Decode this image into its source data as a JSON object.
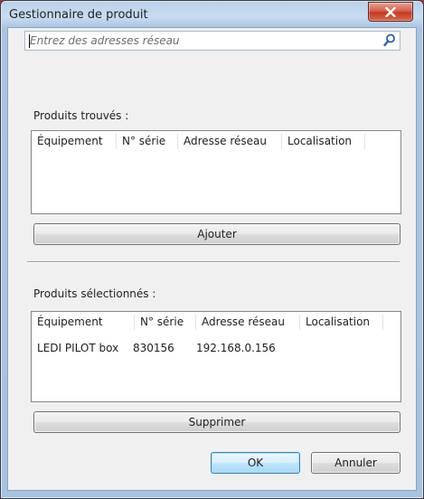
{
  "window": {
    "title": "Gestionnaire de produit"
  },
  "search": {
    "placeholder": "Entrez des adresses réseau",
    "value": ""
  },
  "found": {
    "label": "Produits trouvés :",
    "columns": [
      "Équipement",
      "N° série",
      "Adresse réseau",
      "Localisation"
    ],
    "rows": []
  },
  "add_button": "Ajouter",
  "selected": {
    "label": "Produits sélectionnés :",
    "columns": [
      "Équipement",
      "N° série",
      "Adresse réseau",
      "Localisation"
    ],
    "rows": [
      [
        "LEDI PILOT box",
        "830156",
        "192.168.0.156",
        ""
      ]
    ]
  },
  "remove_button": "Supprimer",
  "ok_button": "OK",
  "cancel_button": "Annuler",
  "colors": {
    "title_close": "#c43a22",
    "ok_accent": "#3c7fb1",
    "search_icon": "#2a5fa8"
  },
  "icons": {
    "close": "close-icon",
    "search": "search-icon"
  }
}
